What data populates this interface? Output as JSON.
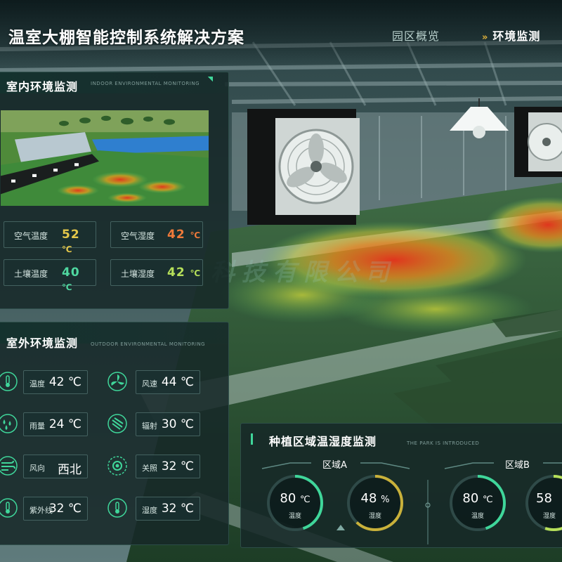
{
  "header": {
    "title": "温室大棚智能控制系统解决方案",
    "nav": [
      {
        "label": "园区概览",
        "active": false
      },
      {
        "label": "环境监测",
        "active": true
      }
    ],
    "nav_chevron": "»"
  },
  "indoor": {
    "title": "室内环境监测",
    "subtitle": "INDOOR ENVIRONMENTAL MONITORING",
    "metrics": [
      {
        "label": "空气温度",
        "value": "52",
        "unit": "℃",
        "color": "#e6c84a"
      },
      {
        "label": "空气湿度",
        "value": "42",
        "unit": "℃",
        "color": "#f07a3a"
      },
      {
        "label": "土壤温度",
        "value": "40",
        "unit": "℃",
        "color": "#4fd8a0"
      },
      {
        "label": "土壤湿度",
        "value": "42",
        "unit": "℃",
        "color": "#b6e05a"
      }
    ]
  },
  "outdoor": {
    "title": "室外环境监测",
    "subtitle": "OUTDOOR ENVIRONMENTAL MONITORING",
    "items": [
      {
        "label": "温度",
        "value": "42 ℃",
        "icon": "thermometer-icon"
      },
      {
        "label": "风速",
        "value": "44 ℃",
        "icon": "fan-icon"
      },
      {
        "label": "雨量",
        "value": "24 ℃",
        "icon": "rain-drops-icon"
      },
      {
        "label": "辐射",
        "value": "30 ℃",
        "icon": "radiation-icon"
      },
      {
        "label": "风向",
        "value": "西北",
        "icon": "wind-direction-icon"
      },
      {
        "label": "关照",
        "value": "32 ℃",
        "icon": "sun-light-icon"
      },
      {
        "label": "紫外线",
        "value": "32 ℃",
        "icon": "uv-thermometer-icon"
      },
      {
        "label": "湿度",
        "value": "32 ℃",
        "icon": "humidity-thermometer-icon"
      }
    ]
  },
  "planting": {
    "title": "种植区域温湿度监测",
    "subtitle": "THE PARK IS INTRODUCED",
    "zones": [
      {
        "name": "区域A",
        "gauges": [
          {
            "value": "80",
            "unit": "℃",
            "label": "温度",
            "fraction": 0.45,
            "color": "#3fd69a"
          },
          {
            "value": "48",
            "unit": "%",
            "label": "湿度",
            "fraction": 0.62,
            "color": "#c9b13a"
          }
        ]
      },
      {
        "name": "区域B",
        "gauges": [
          {
            "value": "80",
            "unit": "℃",
            "label": "温度",
            "fraction": 0.45,
            "color": "#3fd69a"
          },
          {
            "value": "58",
            "unit": "",
            "label": "湿度",
            "fraction": 0.55,
            "color": "#b6e05a"
          }
        ]
      }
    ]
  },
  "watermark": "科技有限公司",
  "colors": {
    "accent": "#3fd69a",
    "warning": "#e0b23a"
  }
}
